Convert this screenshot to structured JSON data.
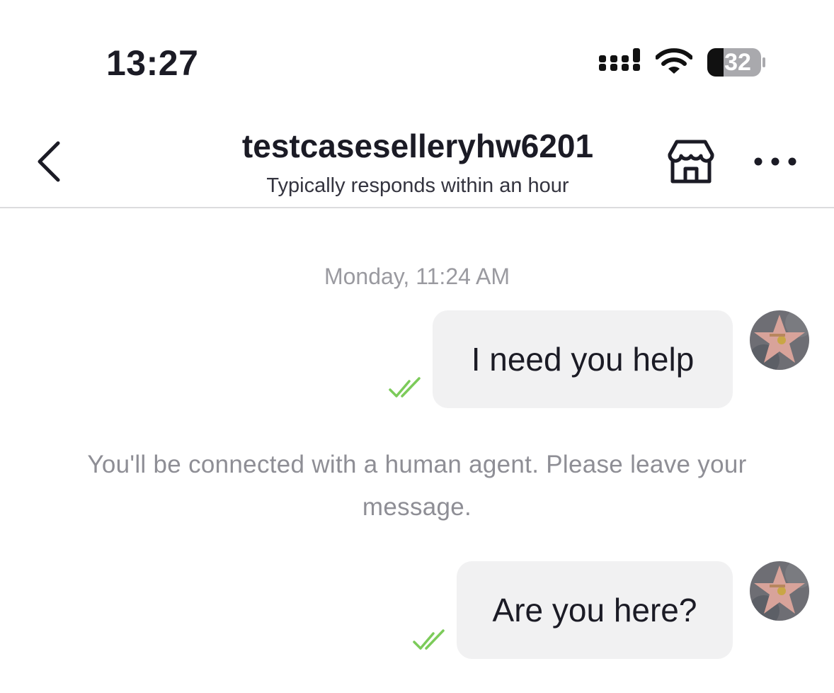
{
  "status_bar": {
    "time": "13:27",
    "battery_level": "32",
    "icons": [
      "signal-icon",
      "wifi-icon",
      "battery-icon"
    ]
  },
  "header": {
    "title": "testcaseselleryhw6201",
    "subtitle": "Typically responds within an hour",
    "icons": [
      "back-chevron-icon",
      "shop-icon",
      "more-icon"
    ]
  },
  "chat": {
    "timestamp": "Monday, 11:24 AM",
    "messages": [
      {
        "text": "I need you help",
        "status": "read"
      },
      {
        "text": "Are you here?",
        "status": "read"
      }
    ],
    "system_message": "You'll be connected with a human agent. Please leave your message."
  },
  "colors": {
    "bubble_bg": "#f1f1f2",
    "read_check": "#7ccb5a",
    "muted_text": "#8e8e95"
  }
}
